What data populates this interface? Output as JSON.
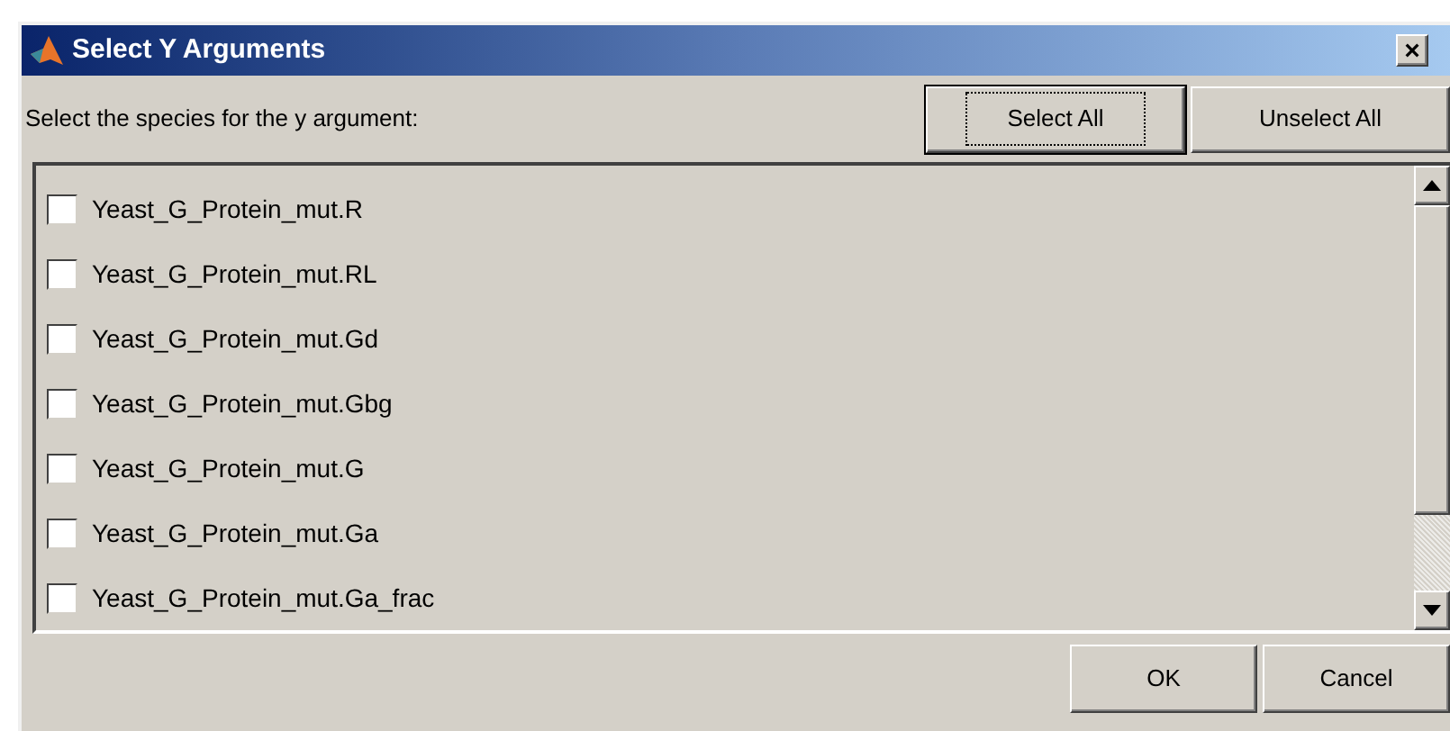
{
  "window": {
    "title": "Select Y Arguments",
    "close": "×"
  },
  "prompt": "Select the species for the y argument:",
  "top_buttons": [
    {
      "label": "Select All",
      "focused": true
    },
    {
      "label": "Unselect All",
      "focused": false
    }
  ],
  "items": [
    {
      "label": "Yeast_G_Protein_mut.R",
      "checked": false
    },
    {
      "label": "Yeast_G_Protein_mut.RL",
      "checked": false
    },
    {
      "label": "Yeast_G_Protein_mut.Gd",
      "checked": false
    },
    {
      "label": "Yeast_G_Protein_mut.Gbg",
      "checked": false
    },
    {
      "label": "Yeast_G_Protein_mut.G",
      "checked": false
    },
    {
      "label": "Yeast_G_Protein_mut.Ga",
      "checked": false
    },
    {
      "label": "Yeast_G_Protein_mut.Ga_frac",
      "checked": false
    }
  ],
  "bottom_buttons": [
    "OK",
    "Cancel"
  ]
}
